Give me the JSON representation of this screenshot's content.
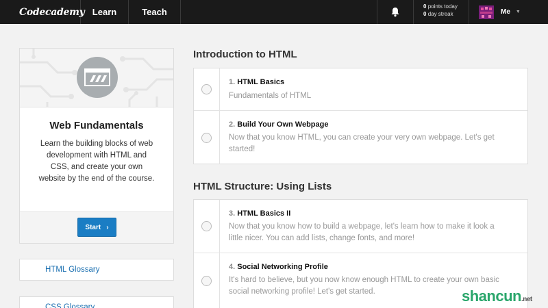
{
  "nav": {
    "brand": "Codecademy",
    "learn": "Learn",
    "teach": "Teach",
    "points_value": "0",
    "points_label": "points today",
    "streak_value": "0",
    "streak_label": "day streak",
    "profile_label": "Me",
    "icons": {
      "notifications": "bell-icon",
      "avatar": "avatar-icon",
      "profile_menu": "caret-down-icon"
    }
  },
  "sidebar": {
    "course_icon": "computer-window-icon",
    "course_title": "Web Fundamentals",
    "course_description": "Learn the building blocks of web development with HTML and CSS, and create your own website by the end of the course.",
    "start_label": "Start",
    "links": [
      "HTML Glossary",
      "CSS Glossary"
    ]
  },
  "sections": [
    {
      "title": "Introduction to HTML",
      "lessons": [
        {
          "number": "1.",
          "title": "HTML Basics",
          "description": "Fundamentals of HTML"
        },
        {
          "number": "2.",
          "title": "Build Your Own Webpage",
          "description": "Now that you know HTML, you can create your very own webpage. Let's get started!"
        }
      ]
    },
    {
      "title": "HTML Structure: Using Lists",
      "lessons": [
        {
          "number": "3.",
          "title": "HTML Basics II",
          "description": "Now that you know how to build a webpage, let's learn how to make it look a little nicer. You can add lists, change fonts, and more!"
        },
        {
          "number": "4.",
          "title": "Social Networking Profile",
          "description": "It's hard to believe, but you now know enough HTML to create your own basic social networking profile! Let's get started."
        }
      ]
    }
  ],
  "watermark": {
    "text": "shancun",
    "suffix": ".net"
  },
  "colors": {
    "topbar": "#1a1a1a",
    "page_background": "#f2f2f2",
    "start_button": "#1a7dc4",
    "link": "#1a6fb0"
  }
}
